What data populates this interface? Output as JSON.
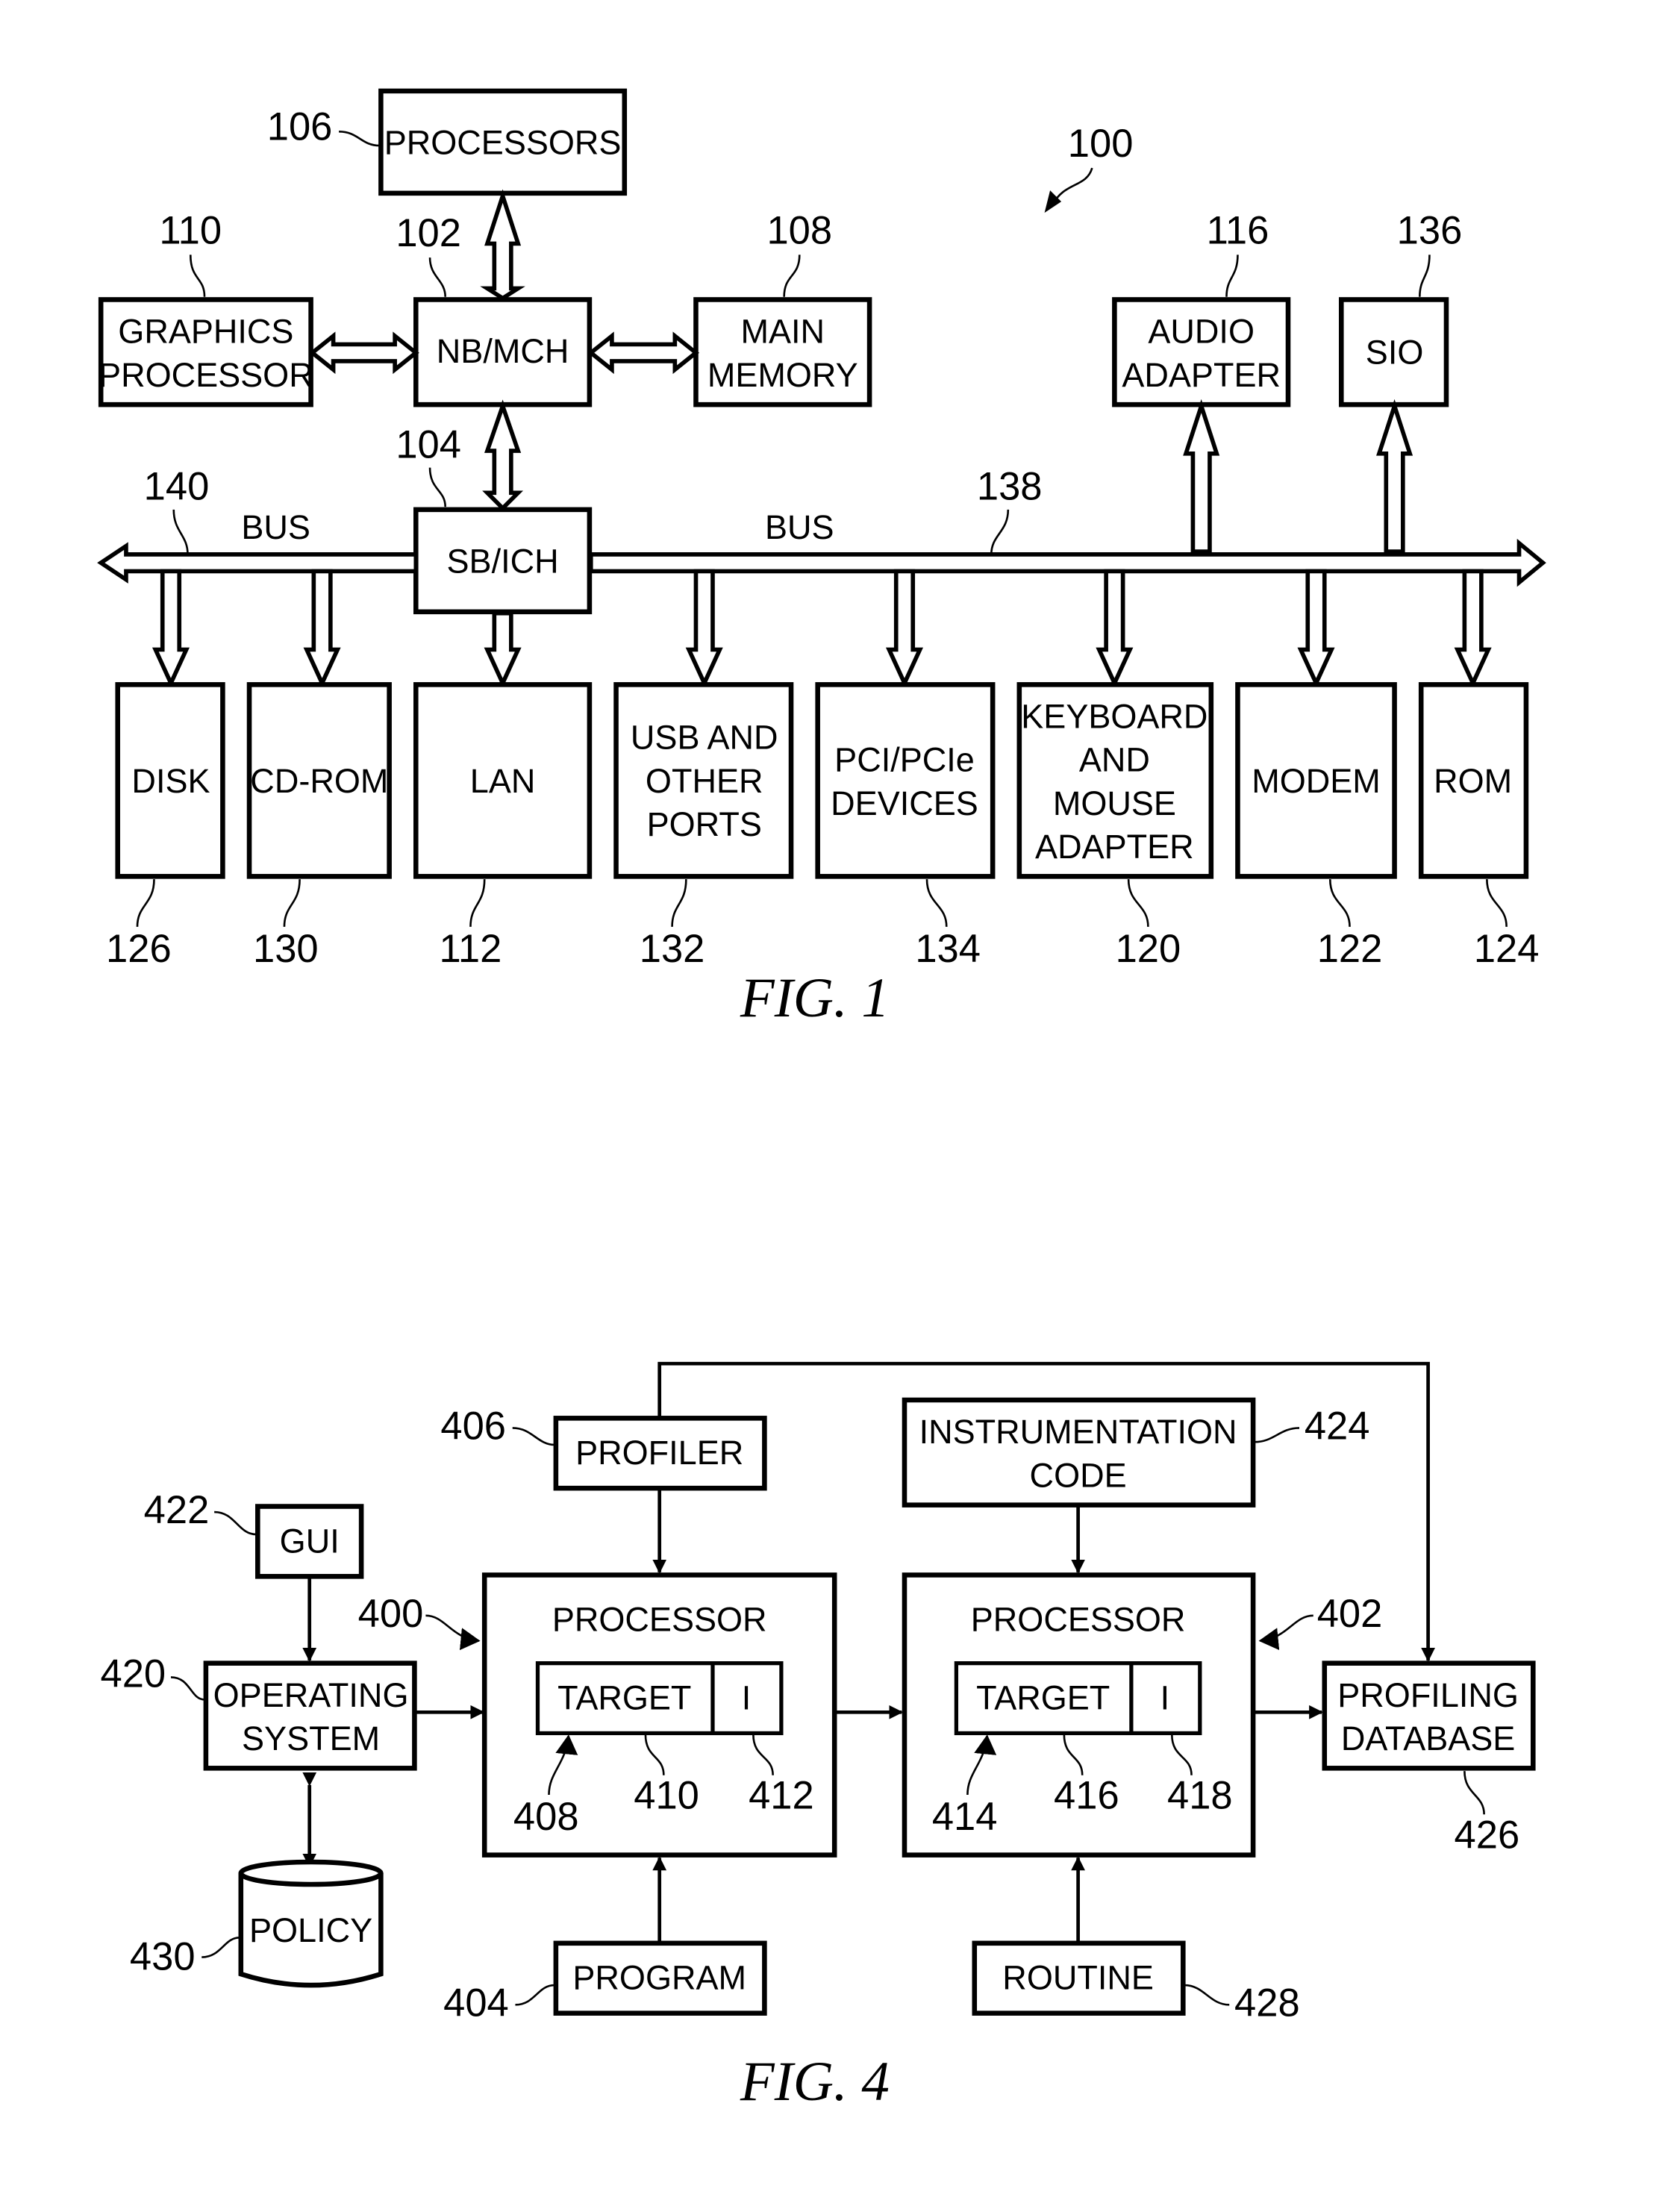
{
  "fig1": {
    "caption": "FIG. 1",
    "system_ref": "100",
    "processors": {
      "label": "PROCESSORS",
      "ref": "106"
    },
    "nb_mch": {
      "label": "NB/MCH",
      "ref": "102"
    },
    "graphics": {
      "line1": "GRAPHICS",
      "line2": "PROCESSOR",
      "ref": "110"
    },
    "main_memory": {
      "line1": "MAIN",
      "line2": "MEMORY",
      "ref": "108"
    },
    "sb_ich": {
      "label": "SB/ICH",
      "ref": "104"
    },
    "audio": {
      "line1": "AUDIO",
      "line2": "ADAPTER",
      "ref": "116"
    },
    "sio": {
      "label": "SIO",
      "ref": "136"
    },
    "bus_left": {
      "label": "BUS",
      "ref": "140"
    },
    "bus_right": {
      "label": "BUS",
      "ref": "138"
    },
    "disk": {
      "label": "DISK",
      "ref": "126"
    },
    "cdrom": {
      "label": "CD-ROM",
      "ref": "130"
    },
    "lan": {
      "label": "LAN",
      "ref": "112"
    },
    "usb": {
      "line1": "USB AND",
      "line2": "OTHER",
      "line3": "PORTS",
      "ref": "132"
    },
    "pci": {
      "line1": "PCI/PCIe",
      "line2": "DEVICES",
      "ref": "134"
    },
    "keyboard": {
      "line1": "KEYBOARD",
      "line2": "AND",
      "line3": "MOUSE",
      "line4": "ADAPTER",
      "ref": "120"
    },
    "modem": {
      "label": "MODEM",
      "ref": "122"
    },
    "rom": {
      "label": "ROM",
      "ref": "124"
    }
  },
  "fig4": {
    "caption": "FIG. 4",
    "profiler": {
      "label": "PROFILER",
      "ref": "406"
    },
    "instrumentation": {
      "line1": "INSTRUMENTATION",
      "line2": "CODE",
      "ref": "424"
    },
    "gui": {
      "label": "GUI",
      "ref": "422"
    },
    "os": {
      "line1": "OPERATING",
      "line2": "SYSTEM",
      "ref": "420"
    },
    "policy": {
      "label": "POLICY",
      "ref": "430"
    },
    "processor1": {
      "label": "PROCESSOR",
      "ref": "400",
      "target": "TARGET",
      "i": "I",
      "ref_arrow": "408",
      "ref_target": "410",
      "ref_i": "412"
    },
    "processor2": {
      "label": "PROCESSOR",
      "ref": "402",
      "target": "TARGET",
      "i": "I",
      "ref_arrow": "414",
      "ref_target": "416",
      "ref_i": "418"
    },
    "profiling_db": {
      "line1": "PROFILING",
      "line2": "DATABASE",
      "ref": "426"
    },
    "program": {
      "label": "PROGRAM",
      "ref": "404"
    },
    "routine": {
      "label": "ROUTINE",
      "ref": "428"
    }
  }
}
